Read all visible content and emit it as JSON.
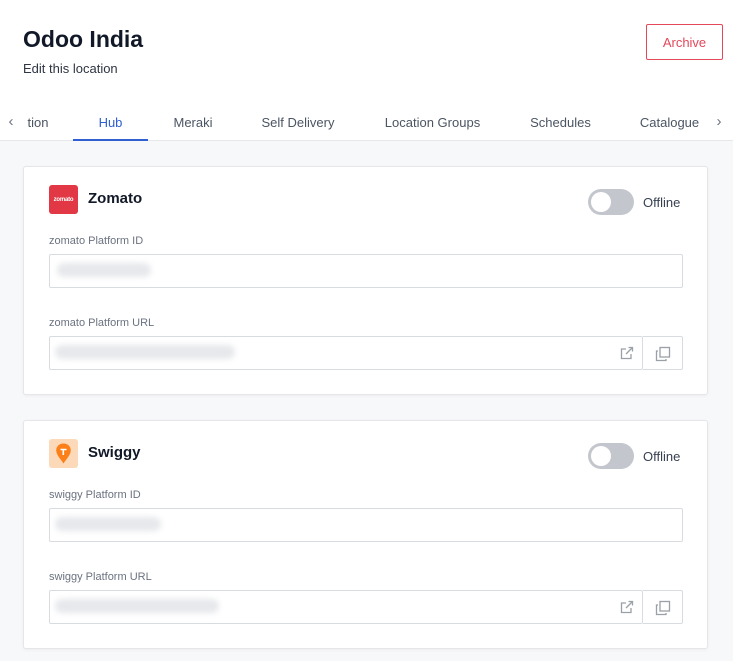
{
  "header": {
    "title": "Odoo India",
    "subtitle": "Edit this location",
    "archive_label": "Archive"
  },
  "tabs": {
    "items": [
      {
        "label": "tion"
      },
      {
        "label": "Hub",
        "active": true
      },
      {
        "label": "Meraki"
      },
      {
        "label": "Self Delivery"
      },
      {
        "label": "Location Groups"
      },
      {
        "label": "Schedules"
      },
      {
        "label": "Catalogue"
      }
    ],
    "prev_icon": "chevron-left-icon",
    "next_icon": "chevron-right-icon"
  },
  "platforms": [
    {
      "name": "Zomato",
      "logo_icon": "zomato-logo",
      "logo_text": "zomato",
      "brand_color": "#e23744",
      "status": "Offline",
      "online": false,
      "id_label": "zomato Platform ID",
      "id_value": "",
      "url_label": "zomato Platform URL",
      "url_value": ""
    },
    {
      "name": "Swiggy",
      "logo_icon": "swiggy-logo",
      "brand_color": "#fc8019",
      "status": "Offline",
      "online": false,
      "id_label": "swiggy Platform ID",
      "id_value": "",
      "url_label": "swiggy Platform URL",
      "url_value": ""
    }
  ],
  "icons": {
    "open_link": "external-link-icon",
    "copy": "copy-icon"
  },
  "colors": {
    "accent": "#2f5fd0",
    "archive": "#e3485b",
    "toggle_off": "#c3c7cd"
  }
}
